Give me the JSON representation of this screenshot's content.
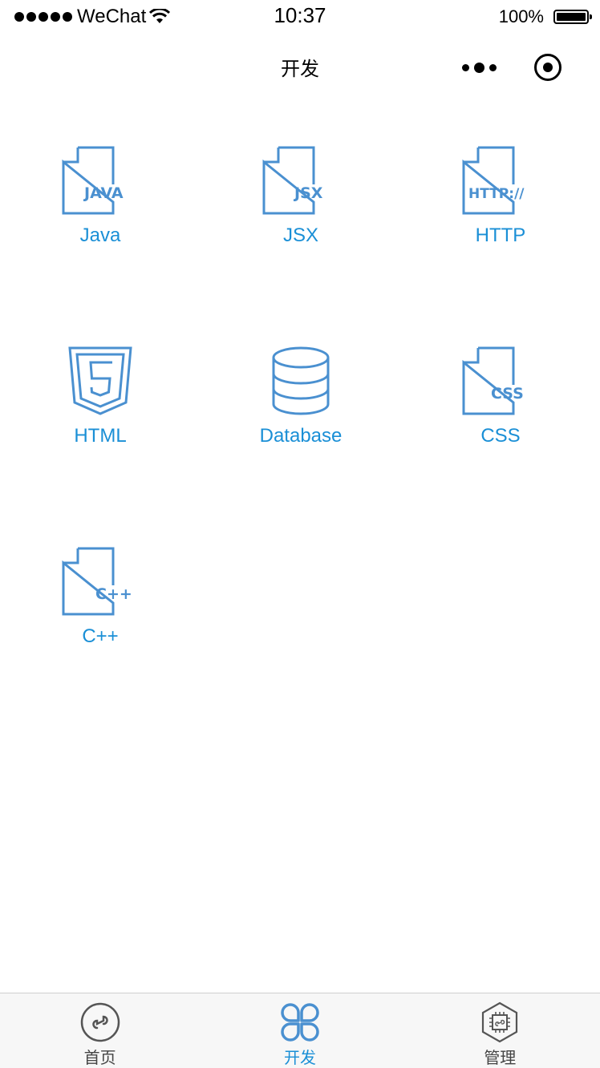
{
  "status_bar": {
    "carrier": "WeChat",
    "time": "10:37",
    "battery": "100%"
  },
  "nav_bar": {
    "title": "开发"
  },
  "grid": {
    "items": [
      {
        "label": "Java",
        "icon": "java-file-icon",
        "badge": "JAVA"
      },
      {
        "label": "JSX",
        "icon": "jsx-file-icon",
        "badge": "JSX"
      },
      {
        "label": "HTTP",
        "icon": "http-file-icon",
        "badge": "HTTP://"
      },
      {
        "label": "HTML",
        "icon": "html5-shield-icon"
      },
      {
        "label": "Database",
        "icon": "database-icon"
      },
      {
        "label": "CSS",
        "icon": "css-file-icon",
        "badge": "CSS"
      },
      {
        "label": "C++",
        "icon": "cpp-file-icon",
        "badge": "C++"
      }
    ]
  },
  "tab_bar": {
    "tabs": [
      {
        "label": "首页",
        "icon": "mini-program-icon",
        "active": false
      },
      {
        "label": "开发",
        "icon": "four-petal-icon",
        "active": true
      },
      {
        "label": "管理",
        "icon": "hexagon-chip-icon",
        "active": false
      }
    ]
  },
  "colors": {
    "accent": "#1a8fd6",
    "icon_stroke": "#4a90d0",
    "tab_inactive": "#555555"
  }
}
